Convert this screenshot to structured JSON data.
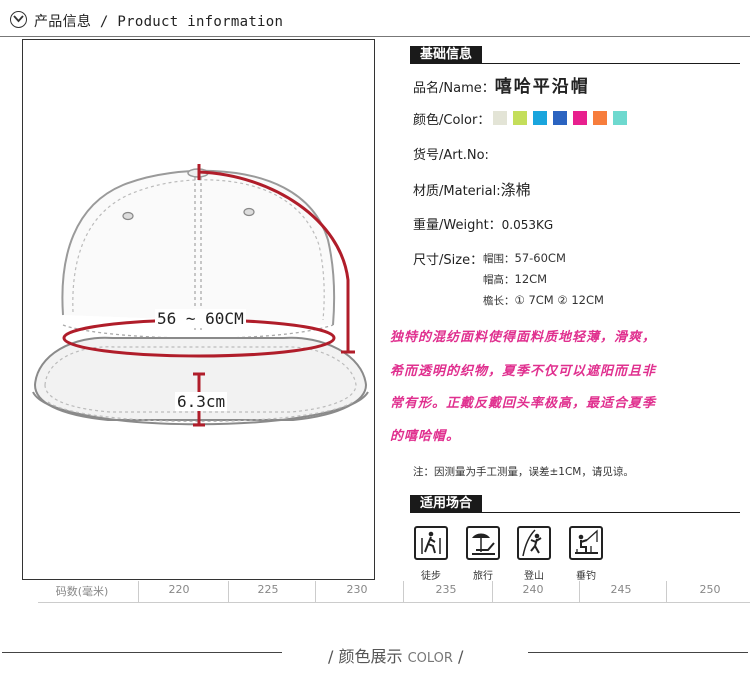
{
  "header": {
    "title": "产品信息 / Product information"
  },
  "image": {
    "circumference_label": "56 ~ 60CM",
    "brim_label": "6.3cm"
  },
  "size_strip": {
    "label": "码数(毫米)",
    "values": [
      "220",
      "225",
      "230",
      "235",
      "240",
      "245",
      "250"
    ]
  },
  "basic_info": {
    "heading": "基础信息",
    "name_label": "品名/Name：",
    "name_value": "嘻哈平沿帽",
    "color_label": "颜色/Color：",
    "swatches": [
      "#e3e4d6",
      "#c4de5a",
      "#1aa5dd",
      "#2b63c0",
      "#e8208e",
      "#f77d3c",
      "#6ed9cf"
    ],
    "artno_label": "货号/Art.No:",
    "material_label": "材质/Material:",
    "material_value": "涤棉",
    "weight_label": "重量/Weight：",
    "weight_value": "0.053KG",
    "size_label": "尺寸/Size：",
    "size_rows": [
      {
        "label": "帽围：",
        "value": "57-60CM"
      },
      {
        "label": "帽高：",
        "value": "12CM"
      },
      {
        "label": "檐长：",
        "value": "① 7CM  ② 12CM"
      }
    ]
  },
  "description": [
    "独特的混纺面料使得面料质地轻薄，滑爽，",
    "希而透明的织物，夏季不仅可以遮阳而且非",
    "常有形。正戴反戴回头率极高，最适合夏季",
    "的嘻哈帽。"
  ],
  "note": "注：因测量为手工测量，误差±1CM，请见谅。",
  "occasions": {
    "heading": "适用场合",
    "items": [
      {
        "label": "徒步",
        "icon": "hiking-icon"
      },
      {
        "label": "旅行",
        "icon": "beach-chair-icon"
      },
      {
        "label": "登山",
        "icon": "climbing-icon"
      },
      {
        "label": "垂钓",
        "icon": "fishing-icon"
      }
    ]
  },
  "footer": {
    "cn": "颜色展示",
    "en": "COLOR"
  }
}
